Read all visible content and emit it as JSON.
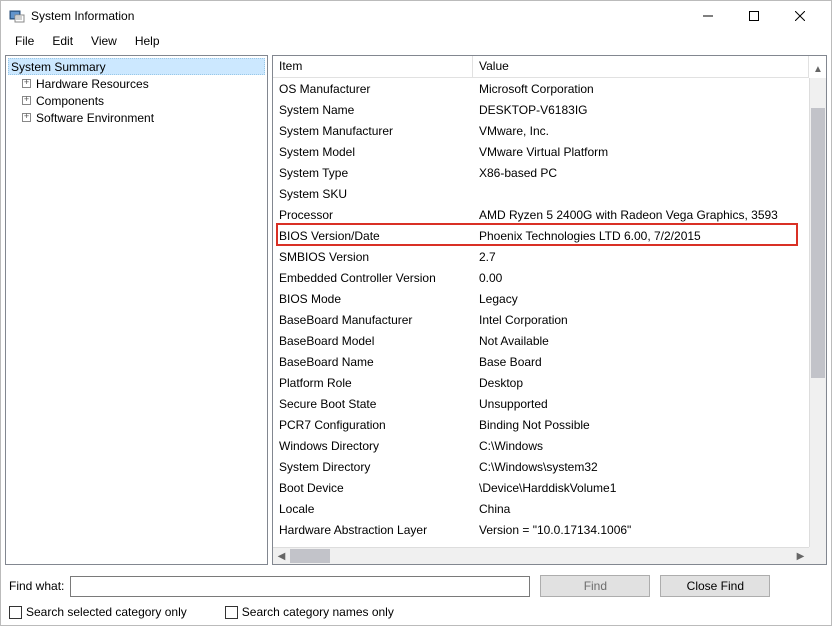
{
  "window": {
    "title": "System Information"
  },
  "menu": {
    "file": "File",
    "edit": "Edit",
    "view": "View",
    "help": "Help"
  },
  "tree": {
    "root": "System Summary",
    "children": [
      "Hardware Resources",
      "Components",
      "Software Environment"
    ]
  },
  "columns": {
    "item": "Item",
    "value": "Value"
  },
  "rows": [
    {
      "item": "OS Manufacturer",
      "value": "Microsoft Corporation"
    },
    {
      "item": "System Name",
      "value": "DESKTOP-V6183IG"
    },
    {
      "item": "System Manufacturer",
      "value": "VMware, Inc."
    },
    {
      "item": "System Model",
      "value": "VMware Virtual Platform"
    },
    {
      "item": "System Type",
      "value": "X86-based PC"
    },
    {
      "item": "System SKU",
      "value": ""
    },
    {
      "item": "Processor",
      "value": "AMD Ryzen 5 2400G with Radeon Vega Graphics, 3593"
    },
    {
      "item": "BIOS Version/Date",
      "value": "Phoenix Technologies LTD 6.00, 7/2/2015",
      "highlight": true
    },
    {
      "item": "SMBIOS Version",
      "value": "2.7"
    },
    {
      "item": "Embedded Controller Version",
      "value": "0.00"
    },
    {
      "item": "BIOS Mode",
      "value": "Legacy"
    },
    {
      "item": "BaseBoard Manufacturer",
      "value": "Intel Corporation"
    },
    {
      "item": "BaseBoard Model",
      "value": "Not Available"
    },
    {
      "item": "BaseBoard Name",
      "value": "Base Board"
    },
    {
      "item": "Platform Role",
      "value": "Desktop"
    },
    {
      "item": "Secure Boot State",
      "value": "Unsupported"
    },
    {
      "item": "PCR7 Configuration",
      "value": "Binding Not Possible"
    },
    {
      "item": "Windows Directory",
      "value": "C:\\Windows"
    },
    {
      "item": "System Directory",
      "value": "C:\\Windows\\system32"
    },
    {
      "item": "Boot Device",
      "value": "\\Device\\HarddiskVolume1"
    },
    {
      "item": "Locale",
      "value": "China"
    },
    {
      "item": "Hardware Abstraction Layer",
      "value": "Version = \"10.0.17134.1006\""
    }
  ],
  "find": {
    "label": "Find what:",
    "value": "",
    "find_btn": "Find",
    "close_btn": "Close Find",
    "cb1": "Search selected category only",
    "cb2": "Search category names only"
  }
}
